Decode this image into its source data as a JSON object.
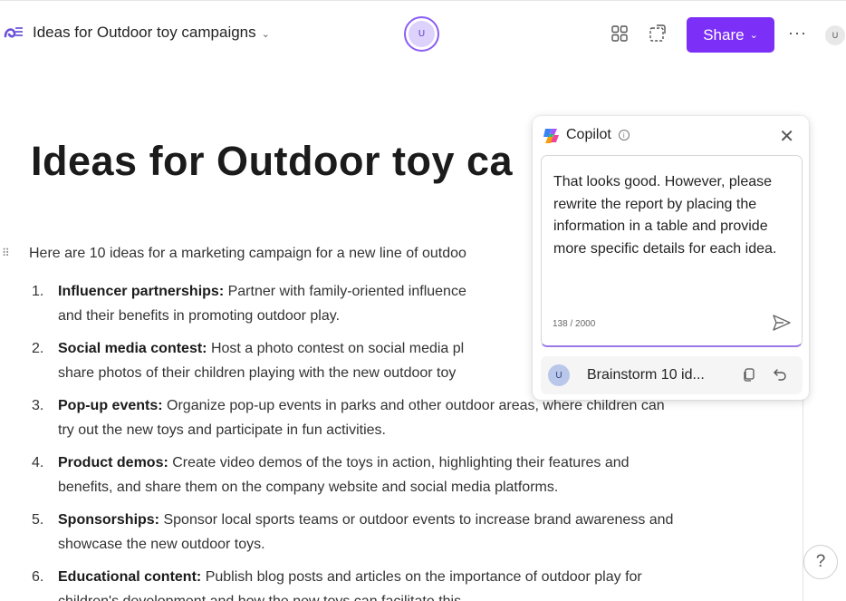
{
  "header": {
    "doc_title": "Ideas for Outdoor toy campaigns",
    "presence_initial": "U",
    "share_label": "Share",
    "more_label": "···",
    "user_initial": "U"
  },
  "document": {
    "title": "Ideas for Outdoor toy ca",
    "intro": "Here are 10 ideas for a marketing campaign for a new line of outdoo",
    "ideas": [
      {
        "num": "1.",
        "title": "Influencer partnerships:",
        "text": "Partner with family-oriented influence",
        "text2": "and their benefits in promoting outdoor play."
      },
      {
        "num": "2.",
        "title": "Social media contest:",
        "text": "Host a photo contest on social media pl",
        "text2": "share photos of their children playing with the new outdoor toy"
      },
      {
        "num": "3.",
        "title": "Pop-up events:",
        "text": "Organize pop-up events in parks and other outdoor areas, where children can",
        "text2": "try out the new toys and participate in fun activities."
      },
      {
        "num": "4.",
        "title": "Product demos:",
        "text": "Create video demos of the toys in action, highlighting their features and",
        "text2": "benefits, and share them on the company website and social media platforms."
      },
      {
        "num": "5.",
        "title": "Sponsorships:",
        "text": "Sponsor local sports teams or outdoor events to increase brand awareness and",
        "text2": "showcase the new outdoor toys."
      },
      {
        "num": "6.",
        "title": "Educational content:",
        "text": "Publish blog posts and articles on the importance of outdoor play for",
        "text2": "children's development and how the new toys can facilitate this."
      }
    ]
  },
  "copilot": {
    "title": "Copilot",
    "prompt_text": "That looks good. However, please rewrite the report by placing the information in a table and provide more specific details for each idea.",
    "char_count": "138 / 2000",
    "suggestion_initial": "U",
    "suggestion_label": "Brainstorm 10 id..."
  },
  "help_label": "?",
  "colors": {
    "share_button": "#7b2ff7",
    "presence_ring": "#8a5cf6",
    "input_focus_border": "#9b7ae8"
  },
  "icons": [
    "loop-app-icon",
    "chevron-down-icon",
    "grid-icon",
    "select-icon",
    "copilot-icon",
    "info-icon",
    "close-icon",
    "send-icon",
    "copy-icon",
    "undo-icon",
    "drag-handle-icon",
    "help-icon"
  ]
}
